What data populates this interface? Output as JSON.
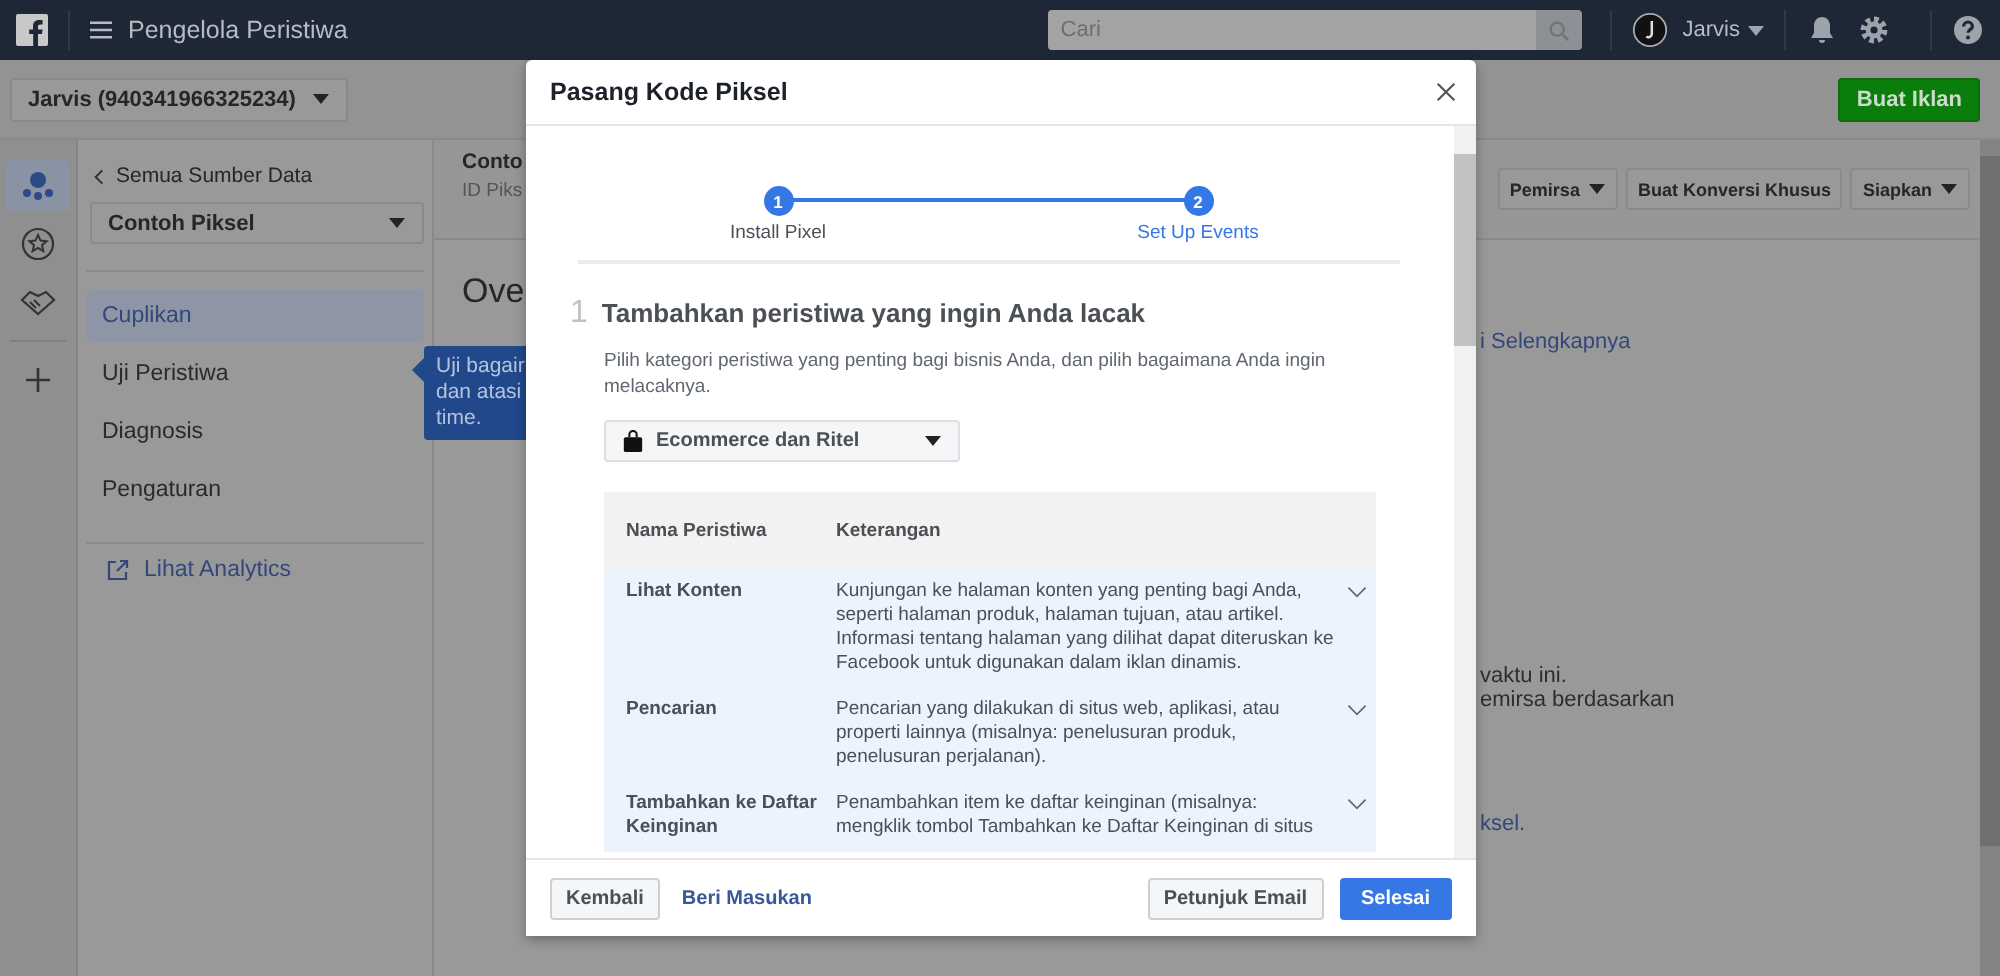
{
  "topbar": {
    "title": "Pengelola Peristiwa",
    "search": {
      "placeholder": "Cari"
    },
    "user": "Jarvis"
  },
  "account_bar": {
    "account": "Jarvis (940341966325234)",
    "create_ad": "Buat Iklan"
  },
  "rail": [
    {
      "kind": "people",
      "selected": true
    },
    {
      "kind": "star",
      "selected": false
    },
    {
      "kind": "handshake",
      "selected": false
    },
    {
      "kind": "add",
      "selected": false
    }
  ],
  "sidebar": {
    "back_link": "Semua Sumber Data",
    "source": "Contoh Piksel",
    "items": [
      {
        "label": "Cuplikan",
        "selected": true
      },
      {
        "label": "Uji Peristiwa",
        "selected": false
      },
      {
        "label": "Diagnosis",
        "selected": false
      },
      {
        "label": "Pengaturan",
        "selected": false
      }
    ],
    "analytics_link": "Lihat Analytics"
  },
  "content": {
    "title": "Conto",
    "subtitle": "ID Piks",
    "buttons": [
      {
        "label": "Pemirsa",
        "dropdown": true
      },
      {
        "label": "Buat Konversi Khusus",
        "dropdown": false
      },
      {
        "label": "Siapkan",
        "dropdown": true
      }
    ],
    "heading": "Ove",
    "fragments": [
      {
        "text": "i Selengkapnya",
        "kind": "link"
      },
      {
        "text": "vaktu ini.",
        "kind": "text"
      },
      {
        "text": "emirsa berdasarkan",
        "kind": "text"
      },
      {
        "text": "ksel.",
        "kind": "link"
      }
    ]
  },
  "tooltip": {
    "lines": [
      "Uji bagair",
      "dan atasi",
      "time."
    ]
  },
  "modal": {
    "title": "Pasang Kode Piksel",
    "steps": [
      {
        "number": "1",
        "label": "Install Pixel",
        "selected": false
      },
      {
        "number": "2",
        "label": "Set Up Events",
        "selected": true
      }
    ],
    "section": {
      "number": "1",
      "heading": "Tambahkan peristiwa yang ingin Anda lacak",
      "description": "Pilih kategori peristiwa yang penting bagi bisnis Anda, dan pilih bagaimana Anda ingin melacaknya.",
      "category": "Ecommerce dan Ritel",
      "columns": [
        "Nama Peristiwa",
        "Keterangan"
      ],
      "rows": [
        {
          "name": "Lihat Konten",
          "description": "Kunjungan ke halaman konten yang penting bagi Anda, seperti halaman produk, halaman tujuan, atau artikel. Informasi tentang halaman yang dilihat dapat diteruskan ke Facebook untuk digunakan dalam iklan dinamis.",
          "expanded": false
        },
        {
          "name": "Pencarian",
          "description": "Pencarian yang dilakukan di situs web, aplikasi, atau properti lainnya (misalnya: penelusuran produk, penelusuran perjalanan).",
          "expanded": false
        },
        {
          "name": "Tambahkan ke Daftar Keinginan",
          "description": "Penambahkan item ke daftar keinginan (misalnya: mengklik tombol Tambahkan ke Daftar Keinginan di situs",
          "expanded": false
        }
      ]
    },
    "footer": {
      "back": "Kembali",
      "feedback": "Beri Masukan",
      "email": "Petunjuk Email",
      "done": "Selesai"
    }
  }
}
